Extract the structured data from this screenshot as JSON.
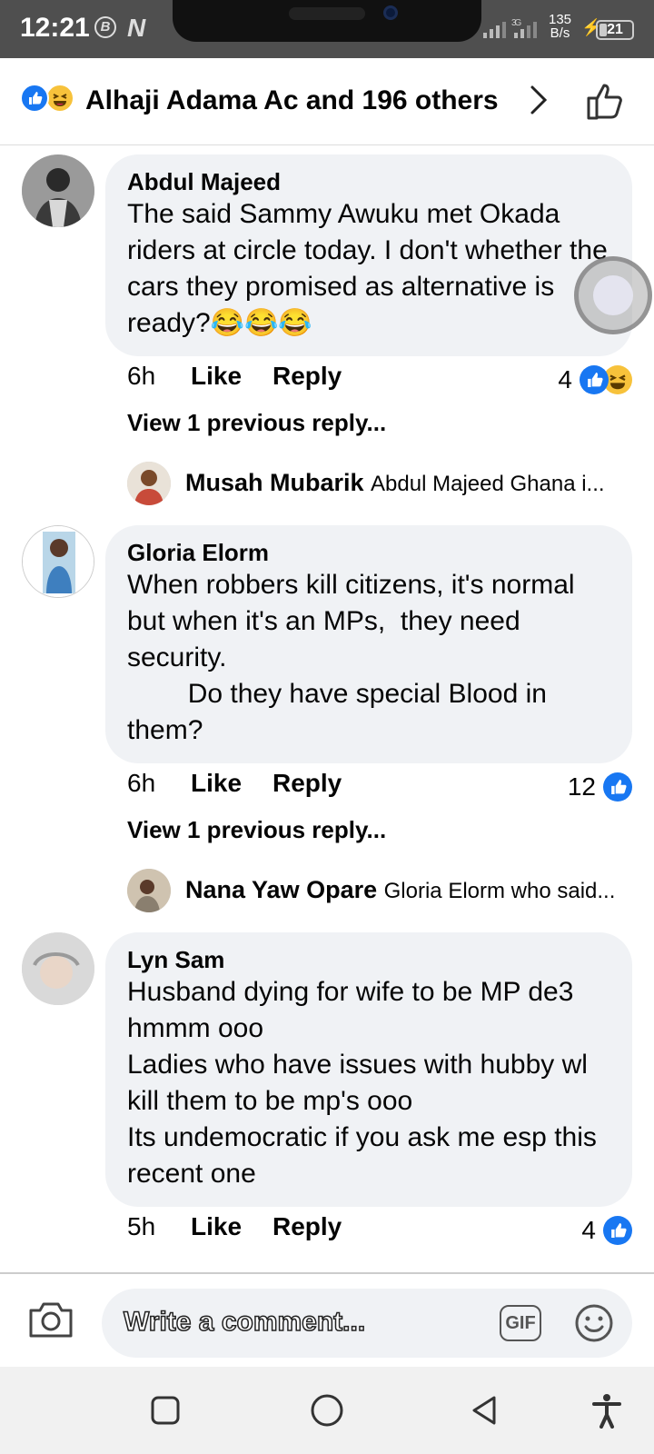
{
  "status_bar": {
    "time": "12:21",
    "icons": [
      "b-circle-icon",
      "n-icon"
    ],
    "network_speed_value": "135",
    "network_speed_unit": "B/s",
    "network_type": "3G",
    "battery": "21"
  },
  "header": {
    "reactors": "Alhaji Adama Ac and 196 others"
  },
  "comments": [
    {
      "author": "Abdul Majeed",
      "text": "The said Sammy Awuku met Okada riders at circle today. I don't whether the cars they promised as alternative is ready?😂😂😂",
      "time": "6h",
      "like": "Like",
      "reply": "Reply",
      "reaction_count": "4",
      "reactions": [
        "like",
        "haha"
      ],
      "view_previous": "View 1 previous reply...",
      "latest_reply": {
        "author": "Musah Mubarik",
        "text": "Abdul Majeed Ghana i..."
      }
    },
    {
      "author": "Gloria Elorm",
      "text": "When robbers kill citizens, it's normal but when it's an MPs,  they need security.\n        Do they have special Blood in them?",
      "time": "6h",
      "like": "Like",
      "reply": "Reply",
      "reaction_count": "12",
      "reactions": [
        "like"
      ],
      "view_previous": "View 1 previous reply...",
      "latest_reply": {
        "author": "Nana Yaw Opare",
        "text": "Gloria Elorm who said..."
      }
    },
    {
      "author": "Lyn Sam",
      "text": "Husband dying for wife to be MP de3 hmmm ooo\nLadies who have issues with hubby wl kill them to be mp's ooo\nIts undemocratic if you ask me esp this recent one",
      "time": "5h",
      "like": "Like",
      "reply": "Reply",
      "reaction_count": "4",
      "reactions": [
        "like"
      ]
    }
  ],
  "composer": {
    "placeholder": "Write a comment...",
    "gif_label": "GIF"
  },
  "colors": {
    "like_blue": "#1877f2",
    "haha_yellow": "#f7c23b",
    "bubble_gray": "#f0f2f5"
  }
}
